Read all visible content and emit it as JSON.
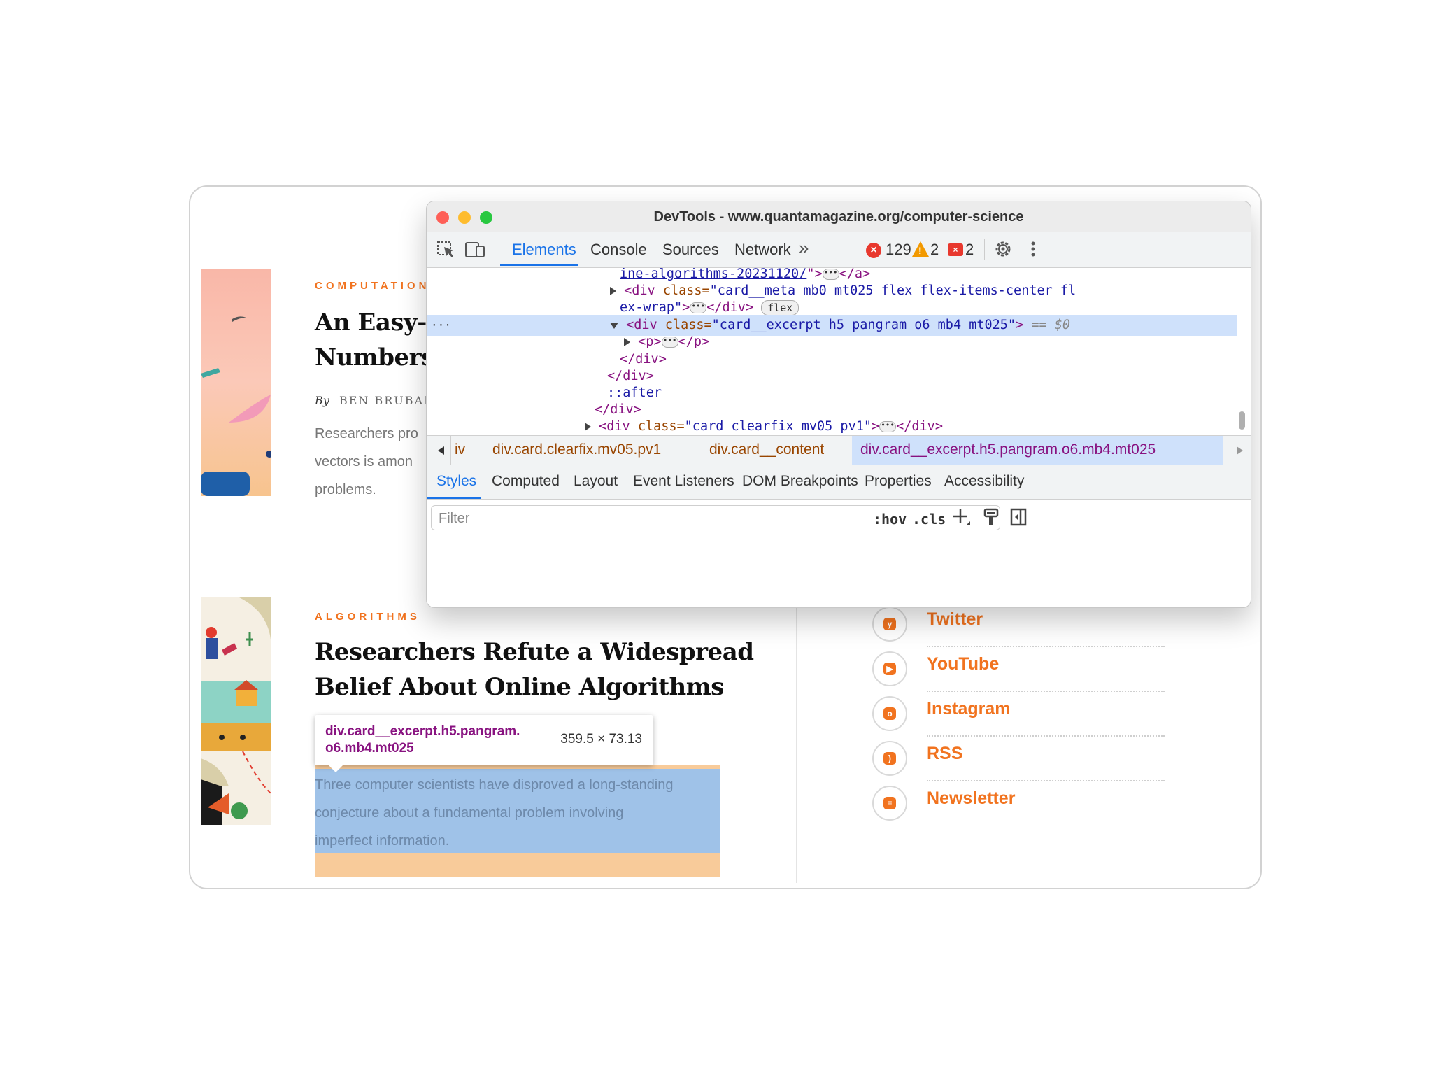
{
  "articles": [
    {
      "kicker": "COMPUTATION",
      "headline_line1": "An Easy-S",
      "headline_line2": "Numbers",
      "by": "By",
      "author": "BEN BRUBAK",
      "excerpt_lines": [
        "Researchers pro",
        "vectors is amon",
        "problems."
      ]
    },
    {
      "kicker": "ALGORITHMS",
      "headline_line1": "Researchers Refute a Widespread",
      "headline_line2": "Belief About Online Algorithms",
      "excerpt_lines": [
        "Three computer scientists have disproved a long-standing",
        "conjecture about a fundamental problem involving",
        "imperfect information."
      ]
    }
  ],
  "inspect_tooltip": {
    "name_line1": "div.card__excerpt.h5.pangram.",
    "name_line2": "o6.mb4.mt025",
    "size": "359.5 × 73.13"
  },
  "social": [
    {
      "label": "Twitter",
      "icon": "twitter-icon",
      "glyph": "y"
    },
    {
      "label": "YouTube",
      "icon": "youtube-icon",
      "glyph": "▶"
    },
    {
      "label": "Instagram",
      "icon": "instagram-icon",
      "glyph": "o"
    },
    {
      "label": "RSS",
      "icon": "rss-icon",
      "glyph": ")"
    },
    {
      "label": "Newsletter",
      "icon": "newsletter-icon",
      "glyph": "≡"
    }
  ],
  "devtools": {
    "title": "DevTools - www.quantamagazine.org/computer-science",
    "tabs": [
      "Elements",
      "Console",
      "Sources",
      "Network"
    ],
    "more_tabs": "»",
    "error_count": "129",
    "warning_count": "2",
    "issue_count": "2",
    "dom": {
      "l1_link": "ine-algorithms-20231120/",
      "l1_end": "\">",
      "l1_close": "</a>",
      "l2_open": "<div ",
      "l2_attr": "class=",
      "l2_val": "\"card__meta mb0 mt025 flex flex-items-center fl",
      "l3_val": "ex-wrap\"",
      "l3_end": ">",
      "l3_close": "</div>",
      "l3_pill": "flex",
      "l4_open": "<div ",
      "l4_attr": "class=",
      "l4_val": "\"card__excerpt h5 pangram o6 mb4 mt025\"",
      "l4_end": ">",
      "l4_eq": " == $0",
      "l5_open": "<p>",
      "l5_close": "</p>",
      "l6": "</div>",
      "l7": "</div>",
      "l8": "::after",
      "l9": "</div>",
      "l10_open": "<div ",
      "l10_attr": "class=",
      "l10_val": "\"card clearfix mv05 pv1\"",
      "l10_end": ">",
      "l10_close": "</div>",
      "gutter": "···"
    },
    "breadcrumbs": [
      "iv",
      "div.card.clearfix.mv05.pv1",
      "div.card__content",
      "div.card__excerpt.h5.pangram.o6.mb4.mt025"
    ],
    "styles_tabs": [
      "Styles",
      "Computed",
      "Layout",
      "Event Listeners",
      "DOM Breakpoints",
      "Properties",
      "Accessibility"
    ],
    "filter_placeholder": "Filter",
    "hov": ":hov",
    "cls": ".cls",
    "colors": {
      "accent": "#1a73e8",
      "selection": "#cfe1fb",
      "tag": "#881280",
      "attr": "#994500",
      "value": "#1a1aa6"
    }
  },
  "colors": {
    "brand": "#f1731f",
    "highlight_content": "#9fc2e8",
    "highlight_margin": "#f8cb9a"
  }
}
